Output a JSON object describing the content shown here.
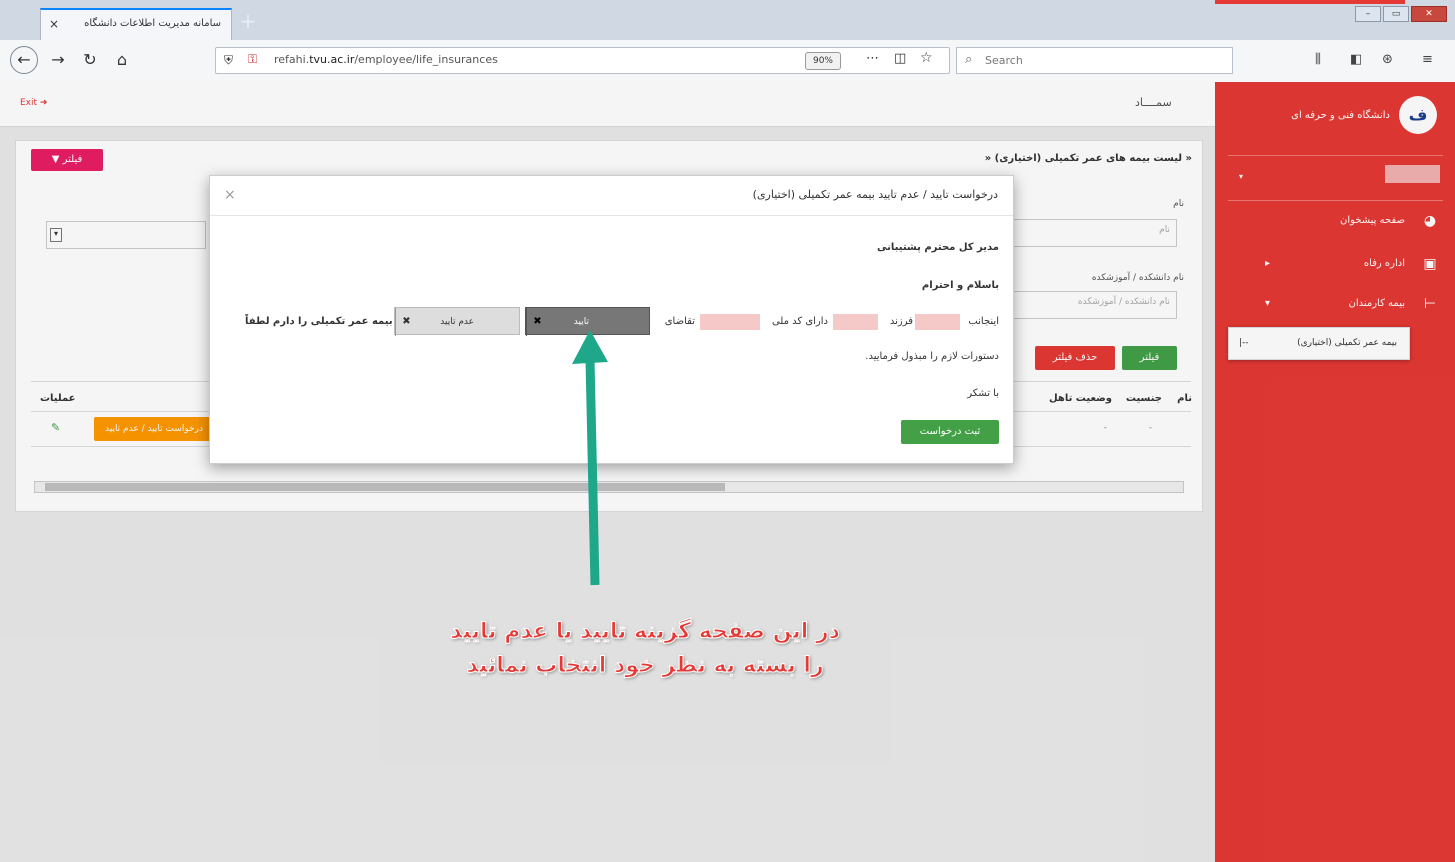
{
  "browser": {
    "tab_title": "سامانه مدیریت اطلاعات دانشگاه",
    "tab_close": "×",
    "new_tab": "+",
    "url_prefix": "refahi.",
    "url_domain": "tvu.ac.ir",
    "url_path": "/employee/life_insurances",
    "zoom": "90%",
    "search_placeholder": "Search",
    "menu_dots": "⋯"
  },
  "app": {
    "logout": "Exit",
    "brand": "سمــــاد",
    "university": "دانشگاه فنی و حرفه ای",
    "logo_letter": "ف"
  },
  "sidebar": {
    "items": [
      {
        "label": "صفحه پیشخوان"
      },
      {
        "label": "اداره رفاه"
      },
      {
        "label": "بیمه کارمندان"
      }
    ],
    "submenu": "بیمه عمر تکمیلی (اختیاری)"
  },
  "card": {
    "filter_btn": "فیلتر",
    "title": "لیست بیمه های عمر تکمیلی (اختیاری)",
    "name_label": "نام",
    "name_placeholder": "نام",
    "faculty_label": "نام دانشکده / آموزشکده",
    "faculty_placeholder": "نام دانشکده / آموزشکده",
    "apply_filter": "فیلتر",
    "remove_filter": "حذف فیلتر",
    "columns": {
      "ops": "عملیات",
      "name": "نام",
      "gender": "جنسیت",
      "marital": "وضعیت تاهل"
    },
    "row_action": "درخواست تایید / عدم تایید",
    "row_status": "-"
  },
  "modal": {
    "title": "درخواست تایید / عدم تایید بیمه عمر تکمیلی (اختیاری)",
    "close": "×",
    "salutation": "مدیر کل محترم پشتیبانی",
    "greeting": "باسلام و احترام",
    "line_start": "اینجانب",
    "child_of": "فرزند",
    "national_code": "دارای کد ملی",
    "request_word": "تقاضای",
    "approve": "تایید",
    "reject": "عدم تایید",
    "insurance_text": "بیمه عمر تکمیلی را دارم لطفاً",
    "line2": "دستورات لازم را مبذول فرمایید.",
    "thanks": "با تشکر",
    "submit": "ثبت درخواست"
  },
  "annotation": {
    "line1": "در این صفحه گزینه تایید یا عدم تایید",
    "line2": "را بسته به نظر خود انتخاب نمائید",
    "arrow_color": "#1fa78a",
    "text_color": "#e53935"
  },
  "colors": {
    "sidebar": "#e53935",
    "filter_pink": "#e91e63",
    "green": "#43a047",
    "orange": "#ff9800"
  }
}
